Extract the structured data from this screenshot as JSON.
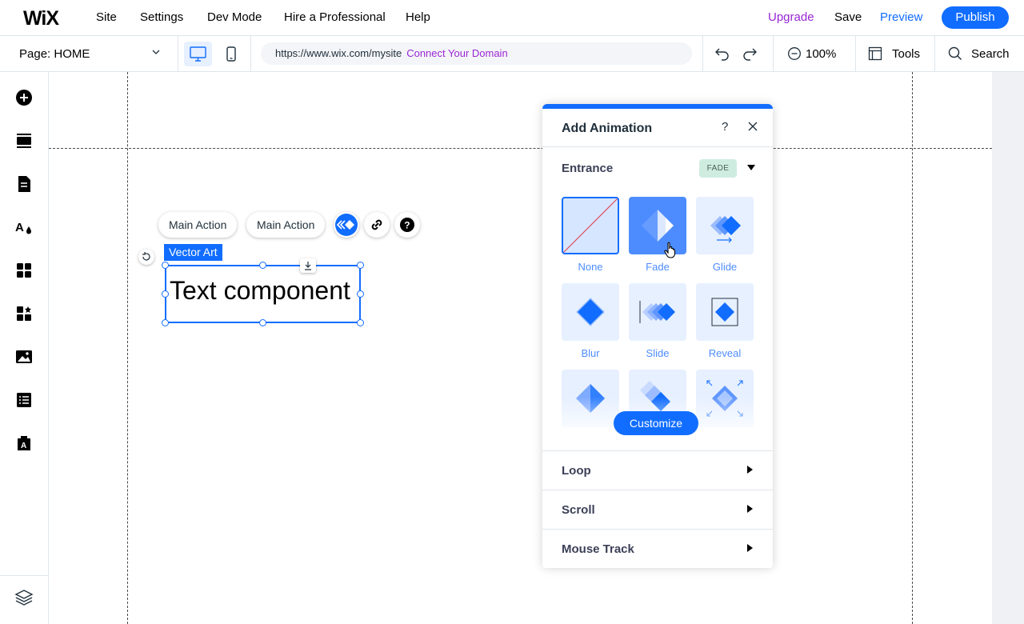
{
  "header": {
    "logo": "WiX",
    "menu": [
      "Site",
      "Settings",
      "Dev Mode",
      "Hire a Professional",
      "Help"
    ],
    "upgrade_label": "Upgrade",
    "save_label": "Save",
    "preview_label": "Preview",
    "publish_label": "Publish"
  },
  "toolbar": {
    "page_prefix": "Page:",
    "page_name": "HOME",
    "url": "https://www.wix.com/mysite",
    "connect_domain": "Connect Your Domain",
    "zoom": "100%",
    "tools_label": "Tools",
    "search_label": "Search"
  },
  "sidebar": {
    "items": [
      "add-elements-icon",
      "sections-icon",
      "pages-icon",
      "theme-icon",
      "apps-icon",
      "business-solutions-icon",
      "media-icon",
      "cms-icon",
      "portfolio-icon",
      "layers-icon"
    ]
  },
  "canvas": {
    "actions": [
      "Main Action",
      "Main Action"
    ],
    "vector_art_tag": "Vector Art",
    "text_component": "Text component"
  },
  "animation_panel": {
    "title": "Add Animation",
    "help": "?",
    "entrance_label": "Entrance",
    "entrance_badge": "FADE",
    "tiles": [
      "None",
      "Fade",
      "Glide",
      "Blur",
      "Slide",
      "Reveal"
    ],
    "customize_label": "Customize",
    "sections": [
      "Loop",
      "Scroll",
      "Mouse Track"
    ]
  },
  "colors": {
    "accent": "#116dff",
    "upgrade": "#9a27d5",
    "fade_badge_bg": "#cfece0"
  }
}
